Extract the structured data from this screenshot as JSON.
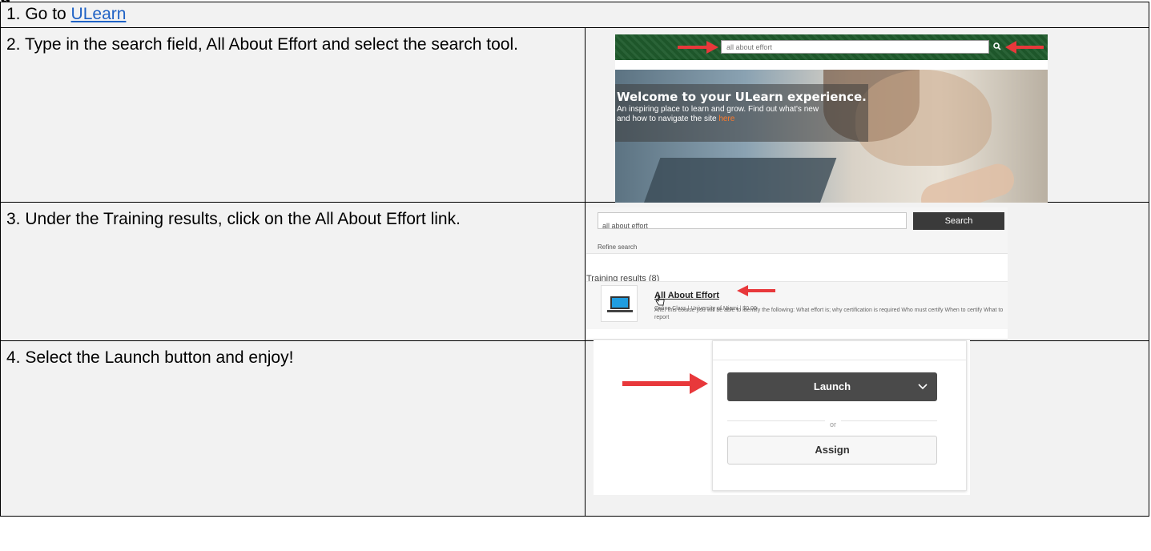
{
  "heading_fragment": "g",
  "steps": {
    "step1": {
      "prefix": "1. Go to ",
      "link": "ULearn"
    },
    "step2": {
      "text": "2. Type in the search field, All About Effort and select the search tool."
    },
    "step3": {
      "text": "3. Under the Training results, click on the All About Effort link."
    },
    "step4": {
      "text": "4. Select the Launch button and enjoy!"
    }
  },
  "shot2": {
    "search_value": "all about effort",
    "carousel_dots": "● ● ● ● ●",
    "welcome_title": "Welcome to your ULearn experience.",
    "welcome_line1": "An inspiring place to learn and grow. Find out what's new",
    "welcome_line2_prefix": "and how to navigate the site ",
    "welcome_link": "here"
  },
  "shot3": {
    "search_value": "all about effort",
    "search_button": "Search",
    "refine": "Refine search",
    "results_heading": "Training results (8)",
    "result_title": "All About Effort",
    "result_meta": "Online Class  |  University of Miami  |  $0.00",
    "result_desc": "After this course you will be able to identify the following: What effort is; why certification is required Who must certify When to certify What to report"
  },
  "shot4": {
    "launch_label": "Launch",
    "or_label": "or",
    "assign_label": "Assign"
  },
  "colors": {
    "link": "#1f62c5",
    "banner_green": "#1f5b2c",
    "arrow_red": "#e8383b",
    "cell_bg": "#f2f2f2"
  }
}
